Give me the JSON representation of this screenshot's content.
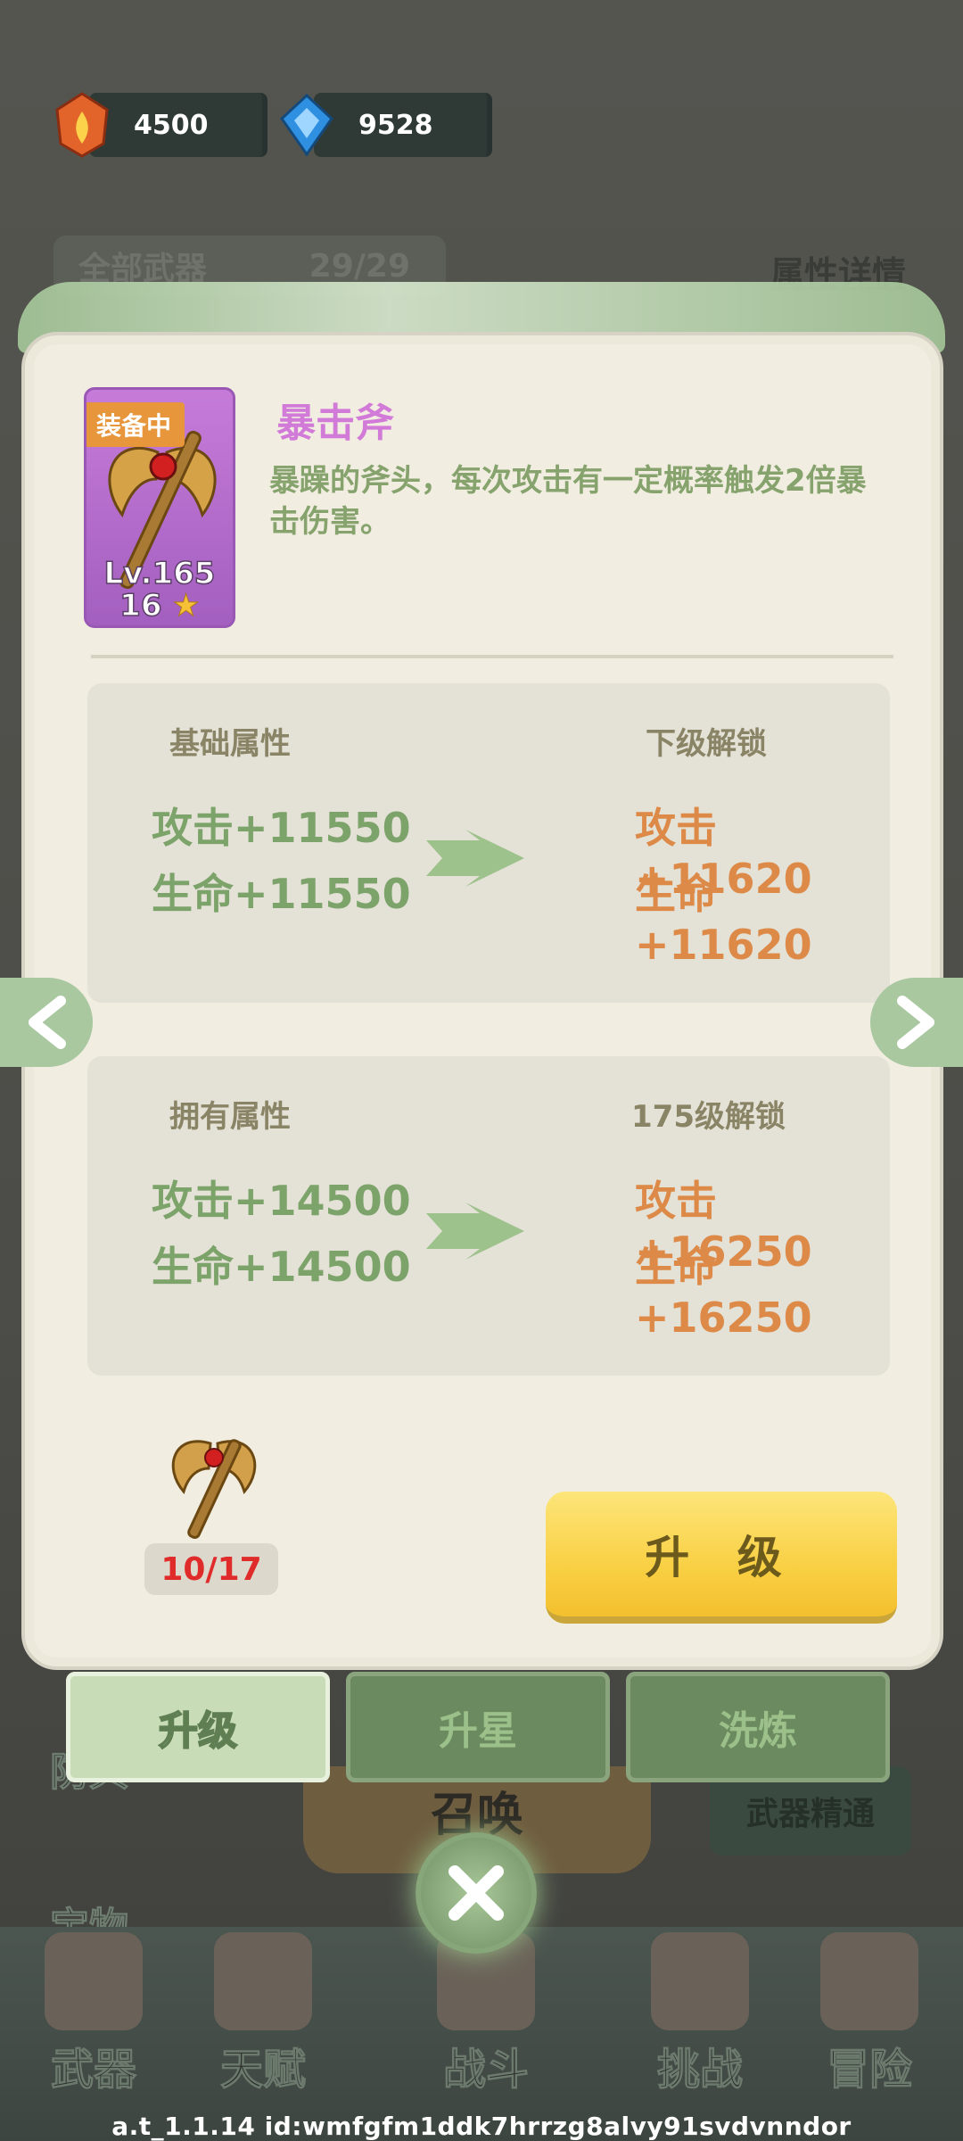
{
  "currency": {
    "gold": {
      "icon": "fire-gem-icon",
      "value": "4500"
    },
    "diamond": {
      "icon": "blue-diamond-icon",
      "value": "9528"
    }
  },
  "background": {
    "all_weapons_label": "全部武器",
    "weapon_count": "29/29",
    "attr_detail_link": "属性详情",
    "side_items": [
      "防具",
      "宝物"
    ],
    "summon_label": "召唤",
    "mastery_label": "武器精通",
    "nav": [
      "武器",
      "天赋",
      "战斗",
      "挑战",
      "冒险"
    ]
  },
  "weapon": {
    "equip_tag": "装备中",
    "level": "Lv.165",
    "stars": "16",
    "name": "暴击斧",
    "description": "暴躁的斧头，每次攻击有一定概率触发2倍暴击伤害。"
  },
  "base_attr": {
    "title": "基础属性",
    "next_title": "下级解锁",
    "current": [
      "攻击+11550",
      "生命+11550"
    ],
    "next": [
      "攻击+11620",
      "生命+11620"
    ]
  },
  "owned_attr": {
    "title": "拥有属性",
    "next_title": "175级解锁",
    "current": [
      "攻击+14500",
      "生命+14500"
    ],
    "next": [
      "攻击+16250",
      "生命+16250"
    ]
  },
  "material": {
    "count": "10/17"
  },
  "upgrade_button": "升 级",
  "tabs": [
    "升级",
    "升星",
    "洗炼"
  ],
  "active_tab": "升级",
  "version": "a.t_1.1.14 id:wmfgfm1ddk7hrrzg8alvy91svdvnndor"
}
